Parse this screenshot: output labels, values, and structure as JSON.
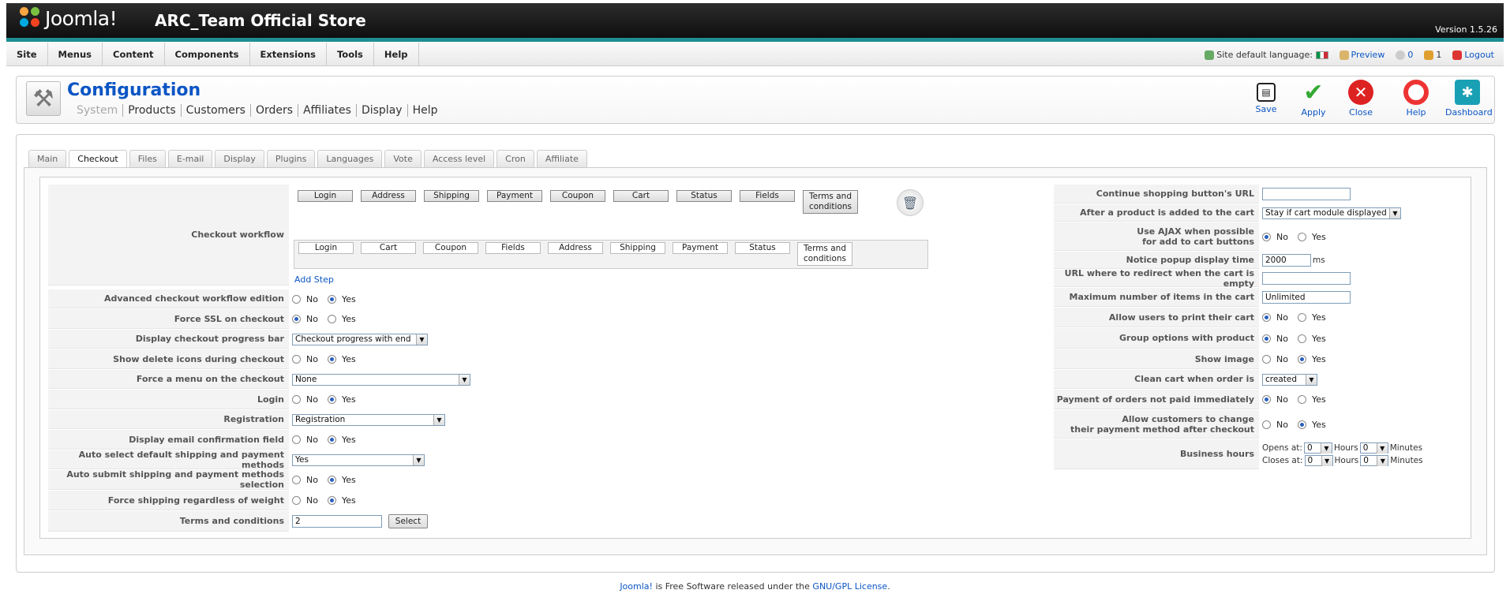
{
  "header": {
    "logo_text": "Joomla!",
    "site_name": "ARC_Team Official Store",
    "version": "Version 1.5.26"
  },
  "menu": [
    "Site",
    "Menus",
    "Content",
    "Components",
    "Extensions",
    "Tools",
    "Help"
  ],
  "status": {
    "language_label": "Site default language:",
    "preview": "Preview",
    "messages": "0",
    "users": "1",
    "logout": "Logout"
  },
  "page": {
    "title": "Configuration",
    "submenu": [
      "System",
      "Products",
      "Customers",
      "Orders",
      "Affiliates",
      "Display",
      "Help"
    ]
  },
  "toolbar": {
    "save": "Save",
    "apply": "Apply",
    "close": "Close",
    "help": "Help",
    "dashboard": "Dashboard"
  },
  "tabs": [
    "Main",
    "Checkout",
    "Files",
    "E-mail",
    "Display",
    "Plugins",
    "Languages",
    "Vote",
    "Access level",
    "Cron",
    "Affiliate"
  ],
  "workflow": {
    "label": "Checkout workflow",
    "row1": [
      "Login",
      "Address",
      "Shipping",
      "Payment",
      "Coupon",
      "Cart",
      "Status",
      "Fields",
      "Terms and conditions"
    ],
    "row2": [
      "Login",
      "Cart",
      "Coupon",
      "Fields",
      "Address",
      "Shipping",
      "Payment",
      "Status",
      "Terms and conditions"
    ],
    "add_step": "Add Step"
  },
  "radio": {
    "no": "No",
    "yes": "Yes"
  },
  "left": {
    "advanced": "Advanced checkout workflow edition",
    "force_ssl": "Force SSL on checkout",
    "progress": "Display checkout progress bar",
    "progress_value": "Checkout progress with end",
    "delete_icons": "Show delete icons during checkout",
    "force_menu": "Force a menu on the checkout",
    "force_menu_value": "None",
    "login": "Login",
    "registration": "Registration",
    "registration_value": "Registration",
    "email_confirm": "Display email confirmation field",
    "auto_select": "Auto select default shipping and payment methods",
    "auto_select_value": "Yes",
    "auto_submit": "Auto submit shipping and payment methods selection",
    "force_shipping": "Force shipping regardless of weight",
    "terms": "Terms and conditions",
    "terms_value": "2",
    "select_btn": "Select"
  },
  "right": {
    "continue_url": "Continue shopping button's URL",
    "continue_url_value": "",
    "after_add": "After a product is added to the cart",
    "after_add_value": "Stay if cart module displayed",
    "ajax_1": "Use AJAX when possible",
    "ajax_2": "for add to cart buttons",
    "popup": "Notice popup display time",
    "popup_value": "2000",
    "popup_unit": "ms",
    "redirect": "URL where to redirect when the cart is empty",
    "redirect_value": "",
    "max_items": "Maximum number of items in the cart",
    "max_items_value": "Unlimited",
    "print": "Allow users to print their cart",
    "group": "Group options with product",
    "image": "Show image",
    "clean": "Clean cart when order is",
    "clean_value": "created",
    "not_paid": "Payment of orders not paid immediately",
    "change_1": "Allow customers to change",
    "change_2": "their payment method after checkout",
    "hours": "Business hours",
    "opens": "Opens at:",
    "closes": "Closes at:",
    "hours_unit": "Hours",
    "minutes_unit": "Minutes",
    "open_h": "0",
    "open_m": "0",
    "close_h": "0",
    "close_m": "0"
  },
  "footer": {
    "part1": "Joomla!",
    "part2": " is Free Software released under the ",
    "part3": "GNU/GPL License",
    "part4": "."
  },
  "colors": {
    "accent": "#0b55c4",
    "header_bar": "#1f8d93"
  }
}
